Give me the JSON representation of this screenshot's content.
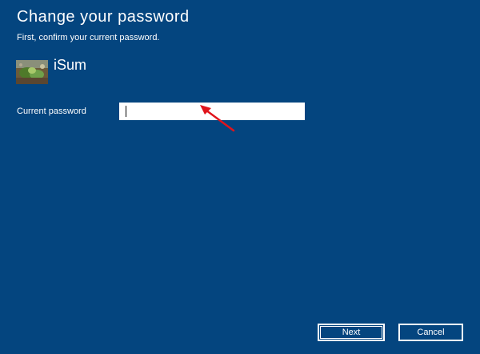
{
  "dialog": {
    "title": "Change your password",
    "subtitle": "First, confirm your current password."
  },
  "account": {
    "username": "iSum",
    "avatar_icon": "user-photo-plant"
  },
  "password_field": {
    "label": "Current password",
    "value": "",
    "placeholder": ""
  },
  "annotation": {
    "arrow_color": "#e0141c"
  },
  "buttons": {
    "next_label": "Next",
    "cancel_label": "Cancel"
  },
  "colors": {
    "background": "#04457f",
    "text": "#ffffff"
  }
}
